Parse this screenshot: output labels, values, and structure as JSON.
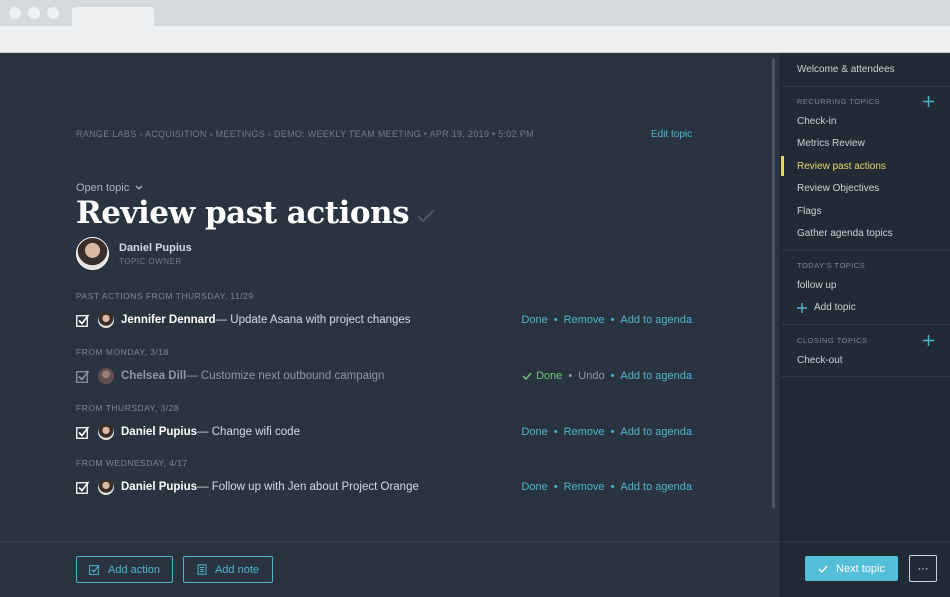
{
  "breadcrumb": "RANGE LABS › ACQUISITION › MEETINGS › DEMO: WEEKLY TEAM MEETING • APR 19, 2019 • 5:02 PM",
  "edit_topic": "Edit topic",
  "open_topic": "Open topic",
  "title": "Review past actions",
  "owner": {
    "name": "Daniel Pupius",
    "role": "TOPIC OWNER"
  },
  "sections": [
    {
      "label": "PAST ACTIONS FROM THURSDAY, 11/29",
      "person": "Jennifer Dennard",
      "text": " — Update Asana with project changes",
      "actions": [
        "Done",
        "Remove",
        "Add to agenda"
      ]
    },
    {
      "label": "FROM MONDAY, 3/18",
      "person": "Chelsea Dill",
      "text": " — Customize next outbound campaign",
      "actions": [
        "Done",
        "Undo",
        "Add to agenda"
      ]
    },
    {
      "label": "FROM THURSDAY, 3/28",
      "person": "Daniel Pupius",
      "text": " — Change wifi code",
      "actions": [
        "Done",
        "Remove",
        "Add to agenda"
      ]
    },
    {
      "label": "FROM WEDNESDAY, 4/17",
      "person": "Daniel Pupius",
      "text": " — Follow up with Jen about Project Orange",
      "actions": [
        "Done",
        "Remove",
        "Add to agenda"
      ]
    }
  ],
  "buttons": {
    "add_action": "Add action",
    "add_note": "Add note",
    "next_topic": "Next topic",
    "more": "···"
  },
  "sidebar": {
    "welcome": "Welcome & attendees",
    "recurring_head": "RECURRING TOPICS",
    "recurring": [
      "Check-in",
      "Metrics Review",
      "Review past actions",
      "Review Objectives",
      "Flags",
      "Gather agenda topics"
    ],
    "today_head": "TODAY'S TOPICS",
    "today": [
      "follow up"
    ],
    "add_topic": "Add topic",
    "closing_head": "CLOSING TOPICS",
    "closing": [
      "Check-out"
    ]
  },
  "colors": {
    "accent": "#4fb3cc",
    "active": "#e8d66b",
    "done": "#6ec07a",
    "background": "#2a3440",
    "sidebar": "#222b35"
  }
}
